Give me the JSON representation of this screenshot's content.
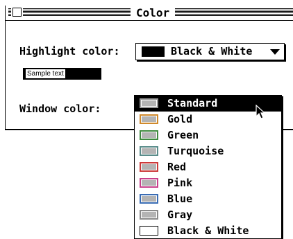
{
  "window": {
    "title": "Color"
  },
  "highlight": {
    "label": "Highlight color:",
    "selected_value": "Black & White",
    "swatch_color": "#000000"
  },
  "sample": {
    "text": "Sample text"
  },
  "window_color": {
    "label": "Window color:",
    "selected_index": 0,
    "options": [
      {
        "label": "Standard",
        "frame_color": "#9a9a9a",
        "fill_color": "#b4b4b4"
      },
      {
        "label": "Gold",
        "frame_color": "#d08a2c",
        "fill_color": "#b4b4b4"
      },
      {
        "label": "Green",
        "frame_color": "#3f8a3f",
        "fill_color": "#b4b4b4"
      },
      {
        "label": "Turquoise",
        "frame_color": "#5a8c8a",
        "fill_color": "#b4b4b4"
      },
      {
        "label": "Red",
        "frame_color": "#cc3a3a",
        "fill_color": "#b4b4b4"
      },
      {
        "label": "Pink",
        "frame_color": "#c8408c",
        "fill_color": "#b4b4b4"
      },
      {
        "label": "Blue",
        "frame_color": "#3a6cb4",
        "fill_color": "#b4b4b4"
      },
      {
        "label": "Gray",
        "frame_color": "#8a8a8a",
        "fill_color": "#b4b4b4"
      },
      {
        "label": "Black & White",
        "frame_color": "#000000",
        "fill_color": "#ffffff"
      }
    ]
  },
  "icons": {
    "close_box": "close-box-icon",
    "popup_arrow": "triangle-down-icon",
    "cursor": "arrow-cursor-icon"
  }
}
